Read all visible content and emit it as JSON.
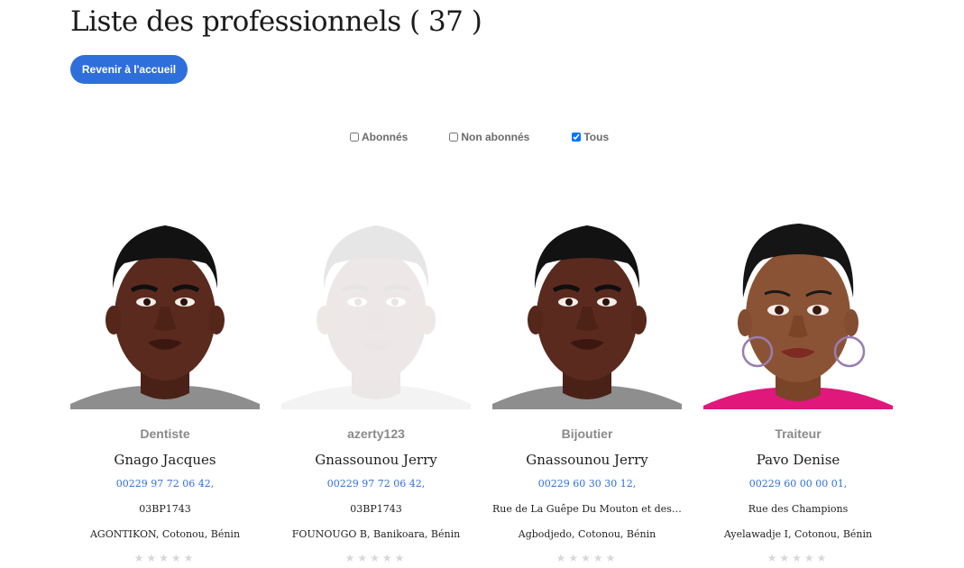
{
  "header": {
    "title": "Liste des professionnels ( 37 )",
    "home_button": "Revenir à l'accueil"
  },
  "filters": [
    {
      "label": "Abonnés",
      "checked": false
    },
    {
      "label": "Non abonnés",
      "checked": false
    },
    {
      "label": "Tous",
      "checked": true
    }
  ],
  "cards": [
    {
      "avatar": "man-avatar",
      "faded": false,
      "profession": "Dentiste",
      "name": "Gnago Jacques",
      "phone": "00229 97 72 06 42,",
      "line1": "03BP1743",
      "line2": "AGONTIKON, Cotonou, Bénin"
    },
    {
      "avatar": "man-avatar",
      "faded": true,
      "profession": "azerty123",
      "name": "Gnassounou Jerry",
      "phone": "00229 97 72 06 42,",
      "line1": "03BP1743",
      "line2": "FOUNOUGO B, Banikoara, Bénin"
    },
    {
      "avatar": "man-avatar",
      "faded": false,
      "profession": "Bijoutier",
      "name": "Gnassounou Jerry",
      "phone": "00229 60 30 30 12,",
      "line1": "Rue de La Guêpe Du Mouton et des Champions",
      "line2": "Agbodjedo, Cotonou, Bénin"
    },
    {
      "avatar": "woman-avatar",
      "faded": false,
      "profession": "Traiteur",
      "name": "Pavo Denise",
      "phone": "00229 60 00 00 01,",
      "line1": "Rue des Champions",
      "line2": "Ayelawadje I, Cotonou, Bénin"
    }
  ],
  "colors": {
    "accent": "#2f6fdc",
    "skin_dark": "#5b2a1e",
    "skin_light": "#8b5336",
    "shirt_grey": "#8e8e8e",
    "shirt_pink": "#e0187c"
  }
}
